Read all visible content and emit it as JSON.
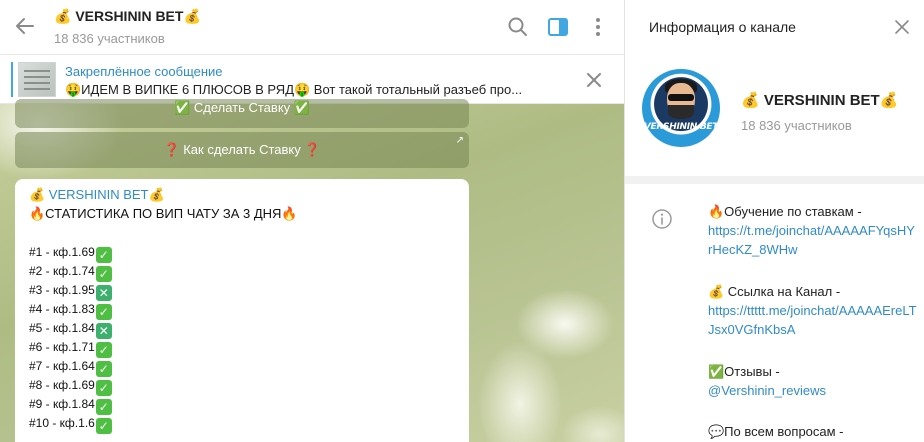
{
  "header": {
    "title": "💰 VERSHININ BET💰",
    "subtitle": "18 836 участников"
  },
  "pinned": {
    "title": "Закреплённое сообщение",
    "text": "🤑ИДЕМ В ВИПКЕ 6 ПЛЮСОВ В РЯД🤑  Вот такой тотальный разъеб про..."
  },
  "chat": {
    "button1_label": "✅ Сделать Ставку ✅",
    "button2_label": "❓ Как сделать Ставку ❓",
    "message": {
      "sender": "💰 VERSHININ BET💰",
      "headline": "🔥СТАТИСТИКА ПО ВИП ЧАТУ ЗА 3 ДНЯ🔥",
      "stats": [
        {
          "label": "#1 - кф.1.69",
          "result": "win"
        },
        {
          "label": "#2 - кф.1.74",
          "result": "win"
        },
        {
          "label": "#3 - кф.1.95",
          "result": "loss"
        },
        {
          "label": "#4 - кф.1.83",
          "result": "win"
        },
        {
          "label": "#5 - кф.1.84",
          "result": "loss"
        },
        {
          "label": "#6 - кф.1.71",
          "result": "win"
        },
        {
          "label": "#7 - кф.1.64",
          "result": "win"
        },
        {
          "label": "#8 - кф.1.69",
          "result": "win"
        },
        {
          "label": "#9 - кф.1.84",
          "result": "win"
        },
        {
          "label": "#10 - кф.1.6",
          "result": "win"
        }
      ]
    }
  },
  "info_panel": {
    "title": "Информация о канале",
    "channel_name": "💰 VERSHININ BET💰",
    "members": "18 836 участников",
    "avatar_text": "VERSHININ BET",
    "sections": [
      {
        "label": "🔥Обучение по ставкам -",
        "link": "https://t.me/joinchat/AAAAAFYqsHYrHecKZ_8WHw"
      },
      {
        "label": "💰 Ссылка на Канал -",
        "link": "https://ttttt.me/joinchat/AAAAAEreLTJsx0VGfnKbsA"
      },
      {
        "label": "✅Отзывы -",
        "link": "@Vershinin_reviews"
      },
      {
        "label": "💬По всем вопросам -",
        "link": ""
      }
    ]
  },
  "colors": {
    "accent": "#40a7e3",
    "link": "#2f8bc9",
    "check_green": "#4fbf43"
  }
}
